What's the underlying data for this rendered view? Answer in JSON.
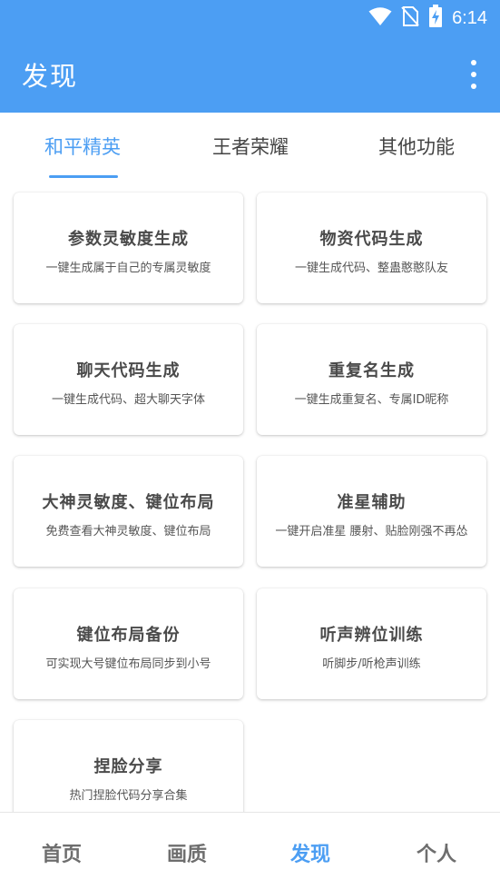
{
  "status_bar": {
    "time": "6:14",
    "icons": [
      "wifi-icon",
      "no-sim-icon",
      "battery-charging-icon"
    ]
  },
  "app_bar": {
    "title": "发现",
    "menu_icon": "more-vert-icon"
  },
  "tabs": [
    {
      "label": "和平精英",
      "active": true
    },
    {
      "label": "王者荣耀",
      "active": false
    },
    {
      "label": "其他功能",
      "active": false
    }
  ],
  "cards": [
    {
      "title": "参数灵敏度生成",
      "desc": "一键生成属于自己的专属灵敏度"
    },
    {
      "title": "物资代码生成",
      "desc": "一键生成代码、整蛊憨憨队友"
    },
    {
      "title": "聊天代码生成",
      "desc": "一键生成代码、超大聊天字体"
    },
    {
      "title": "重复名生成",
      "desc": "一键生成重复名、专属ID昵称"
    },
    {
      "title": "大神灵敏度、键位布局",
      "desc": "免费查看大神灵敏度、键位布局"
    },
    {
      "title": "准星辅助",
      "desc": "一键开启准星 腰射、贴脸刚强不再怂"
    },
    {
      "title": "键位布局备份",
      "desc": "可实现大号键位布局同步到小号"
    },
    {
      "title": "听声辨位训练",
      "desc": "听脚步/听枪声训练"
    },
    {
      "title": "捏脸分享",
      "desc": "热门捏脸代码分享合集"
    }
  ],
  "bottom_nav": [
    {
      "label": "首页",
      "active": false
    },
    {
      "label": "画质",
      "active": false
    },
    {
      "label": "发现",
      "active": true
    },
    {
      "label": "个人",
      "active": false
    }
  ],
  "colors": {
    "primary": "#4c9ef3",
    "inactive_text": "#6e6e6e"
  }
}
